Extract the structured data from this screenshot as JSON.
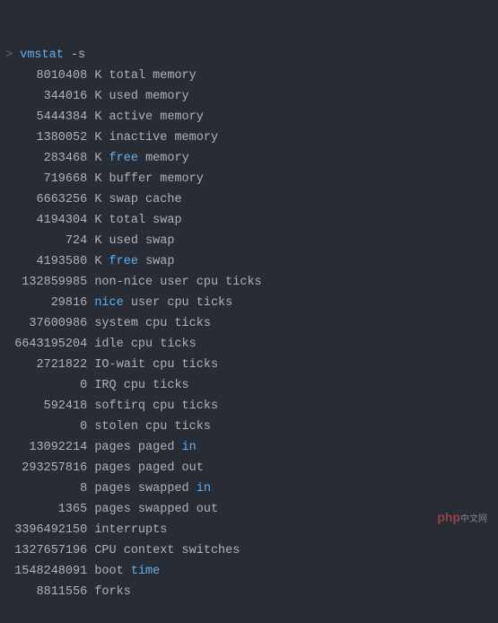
{
  "command": {
    "name": "vmstat",
    "args": "-s",
    "prompt": ">"
  },
  "lines": [
    {
      "value": "8010408",
      "unit": "K",
      "kw": null,
      "label": "total memory"
    },
    {
      "value": "344016",
      "unit": "K",
      "kw": null,
      "label": "used memory"
    },
    {
      "value": "5444384",
      "unit": "K",
      "kw": null,
      "label": "active memory"
    },
    {
      "value": "1380052",
      "unit": "K",
      "kw": null,
      "label": "inactive memory"
    },
    {
      "value": "283468",
      "unit": "K",
      "kw": "free",
      "label": "memory"
    },
    {
      "value": "719668",
      "unit": "K",
      "kw": null,
      "label": "buffer memory"
    },
    {
      "value": "6663256",
      "unit": "K",
      "kw": null,
      "label": "swap cache"
    },
    {
      "value": "4194304",
      "unit": "K",
      "kw": null,
      "label": "total swap"
    },
    {
      "value": "724",
      "unit": "K",
      "kw": null,
      "label": "used swap"
    },
    {
      "value": "4193580",
      "unit": "K",
      "kw": "free",
      "label": "swap"
    },
    {
      "value": "132859985",
      "unit": null,
      "kw": null,
      "label": "non-nice user cpu ticks"
    },
    {
      "value": "29816",
      "unit": null,
      "kw": "nice",
      "label": "user cpu ticks"
    },
    {
      "value": "37600986",
      "unit": null,
      "kw": null,
      "label": "system cpu ticks"
    },
    {
      "value": "6643195204",
      "unit": null,
      "kw": null,
      "label": "idle cpu ticks"
    },
    {
      "value": "2721822",
      "unit": null,
      "kw": null,
      "label": "IO-wait cpu ticks"
    },
    {
      "value": "0",
      "unit": null,
      "kw": null,
      "label": "IRQ cpu ticks"
    },
    {
      "value": "592418",
      "unit": null,
      "kw": null,
      "label": "softirq cpu ticks"
    },
    {
      "value": "0",
      "unit": null,
      "kw": null,
      "label": "stolen cpu ticks"
    },
    {
      "value": "13092214",
      "unit": null,
      "kw": null,
      "label": "pages paged",
      "suffix_kw": "in"
    },
    {
      "value": "293257816",
      "unit": null,
      "kw": null,
      "label": "pages paged out"
    },
    {
      "value": "8",
      "unit": null,
      "kw": null,
      "label": "pages swapped",
      "suffix_kw": "in"
    },
    {
      "value": "1365",
      "unit": null,
      "kw": null,
      "label": "pages swapped out"
    },
    {
      "value": "3396492150",
      "unit": null,
      "kw": null,
      "label": "interrupts"
    },
    {
      "value": "1327657196",
      "unit": null,
      "kw": null,
      "label": "CPU context switches"
    },
    {
      "value": "1548248091",
      "unit": null,
      "kw": null,
      "label": "boot",
      "suffix_kw": "time"
    },
    {
      "value": "8811556",
      "unit": null,
      "kw": null,
      "label": "forks"
    }
  ],
  "watermark": {
    "brand": "php",
    "suffix": "中文网"
  },
  "colors": {
    "bg": "#282c34",
    "text": "#abb2bf",
    "keyword": "#61afef"
  }
}
